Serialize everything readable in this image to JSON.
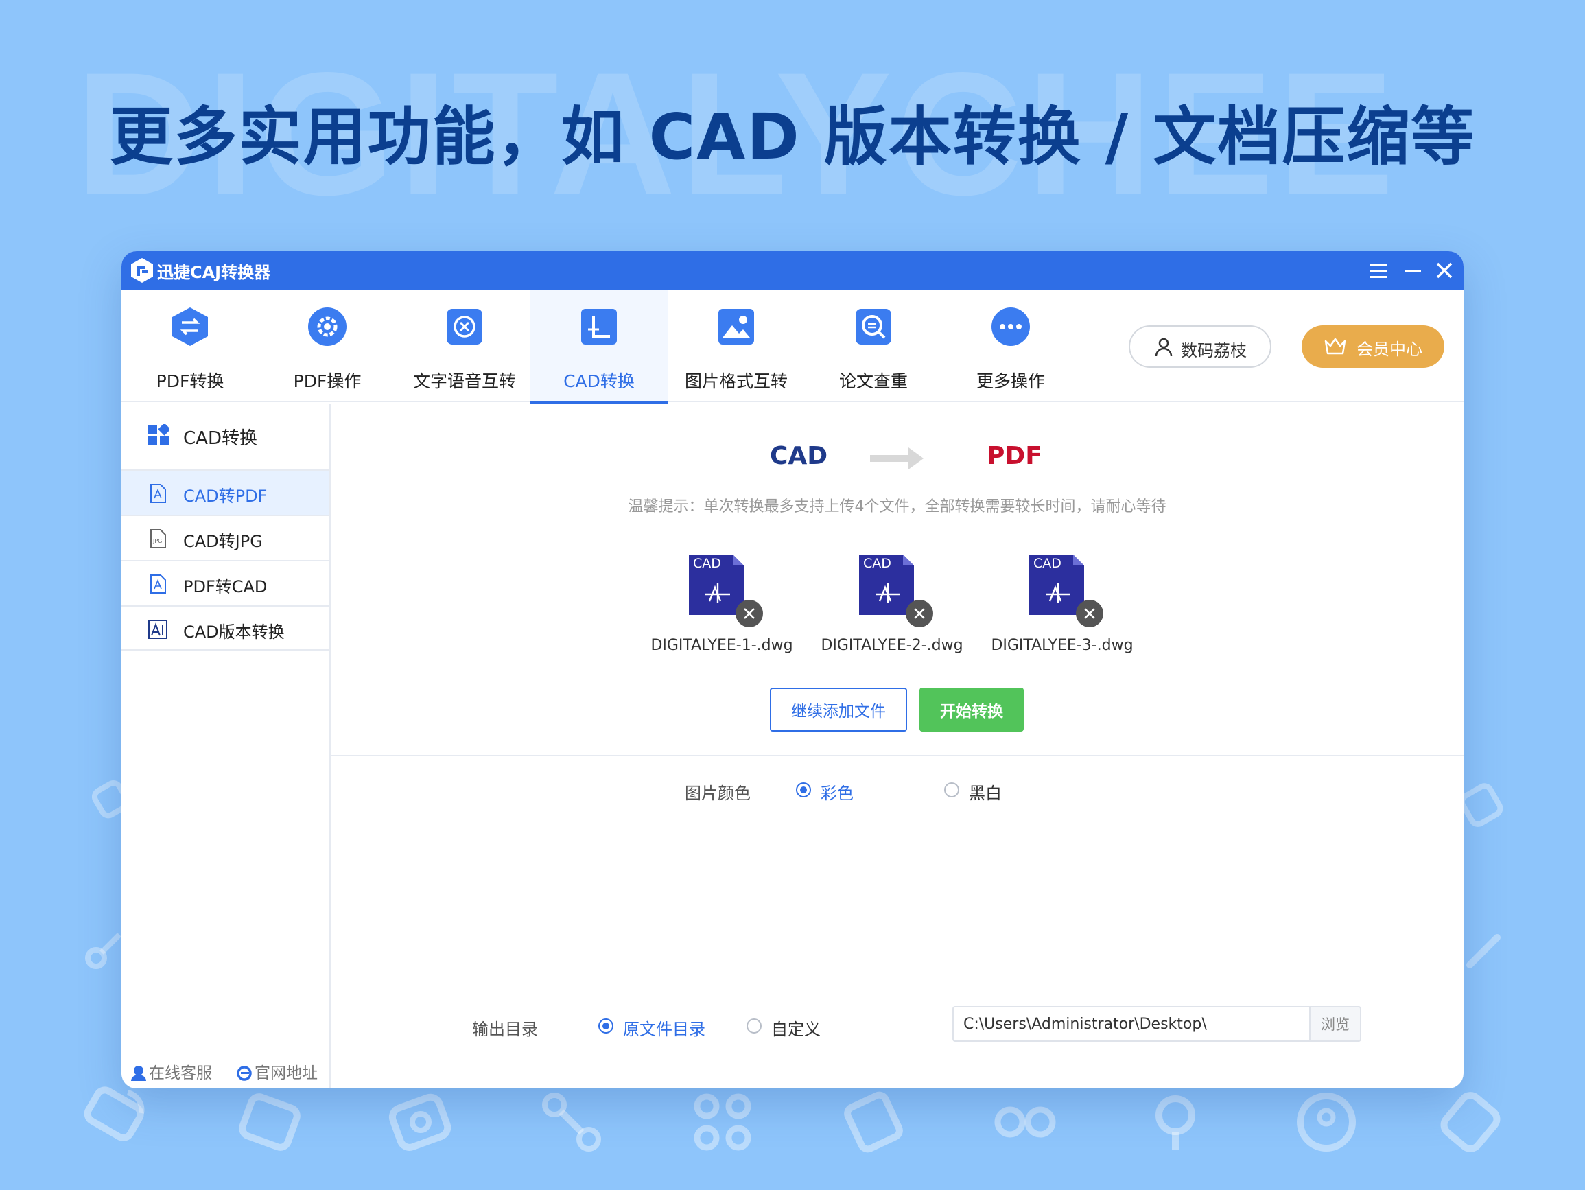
{
  "banner": {
    "watermark": "DIGITALYCHEE",
    "headline": "更多实用功能，如 CAD 版本转换 / 文档压缩等"
  },
  "window": {
    "title": "迅捷CAJ转换器",
    "controls": {
      "menu": "menu-icon",
      "minimize": "minimize-icon",
      "close": "close-icon"
    }
  },
  "toolbar": {
    "tabs": [
      {
        "label": "PDF转换",
        "icon": "pdf-convert-icon"
      },
      {
        "label": "PDF操作",
        "icon": "gear-icon"
      },
      {
        "label": "文字语音互转",
        "icon": "text-speech-icon"
      },
      {
        "label": "CAD转换",
        "icon": "cad-icon",
        "active": true
      },
      {
        "label": "图片格式互转",
        "icon": "image-icon"
      },
      {
        "label": "论文查重",
        "icon": "search-doc-icon"
      },
      {
        "label": "更多操作",
        "icon": "more-icon"
      }
    ],
    "user_label": "数码荔枝",
    "vip_label": "会员中心"
  },
  "sidebar": {
    "header": "CAD转换",
    "items": [
      {
        "label": "CAD转PDF",
        "icon": "pdf-file-icon",
        "active": true
      },
      {
        "label": "CAD转JPG",
        "icon": "jpg-file-icon"
      },
      {
        "label": "PDF转CAD",
        "icon": "pdf-file-icon"
      },
      {
        "label": "CAD版本转换",
        "icon": "cad-version-icon"
      }
    ],
    "footer": {
      "service": "在线客服",
      "website": "官网地址"
    }
  },
  "main": {
    "from": "CAD",
    "to": "PDF",
    "tip": "温馨提示：单次转换最多支持上传4个文件，全部转换需要较长时间，请耐心等待",
    "file_badge": "CAD",
    "files": [
      {
        "name": "DIGITALYEE-1-.dwg"
      },
      {
        "name": "DIGITALYEE-2-.dwg"
      },
      {
        "name": "DIGITALYEE-3-.dwg"
      }
    ],
    "add_button": "继续添加文件",
    "start_button": "开始转换",
    "color_option": {
      "label": "图片颜色",
      "choices": [
        "彩色",
        "黑白"
      ],
      "selected": "彩色"
    },
    "output": {
      "label": "输出目录",
      "choices": [
        "原文件目录",
        "自定义"
      ],
      "selected": "原文件目录",
      "path": "C:\\Users\\Administrator\\Desktop\\",
      "browse": "浏览"
    }
  },
  "colors": {
    "background": "#8ec5fb",
    "accent": "#2f6ee6",
    "vip": "#e9ac4c",
    "start": "#52c45a",
    "cad_text": "#1f3a8a",
    "pdf_text": "#c8102e",
    "file_icon": "#2c2f9e"
  }
}
